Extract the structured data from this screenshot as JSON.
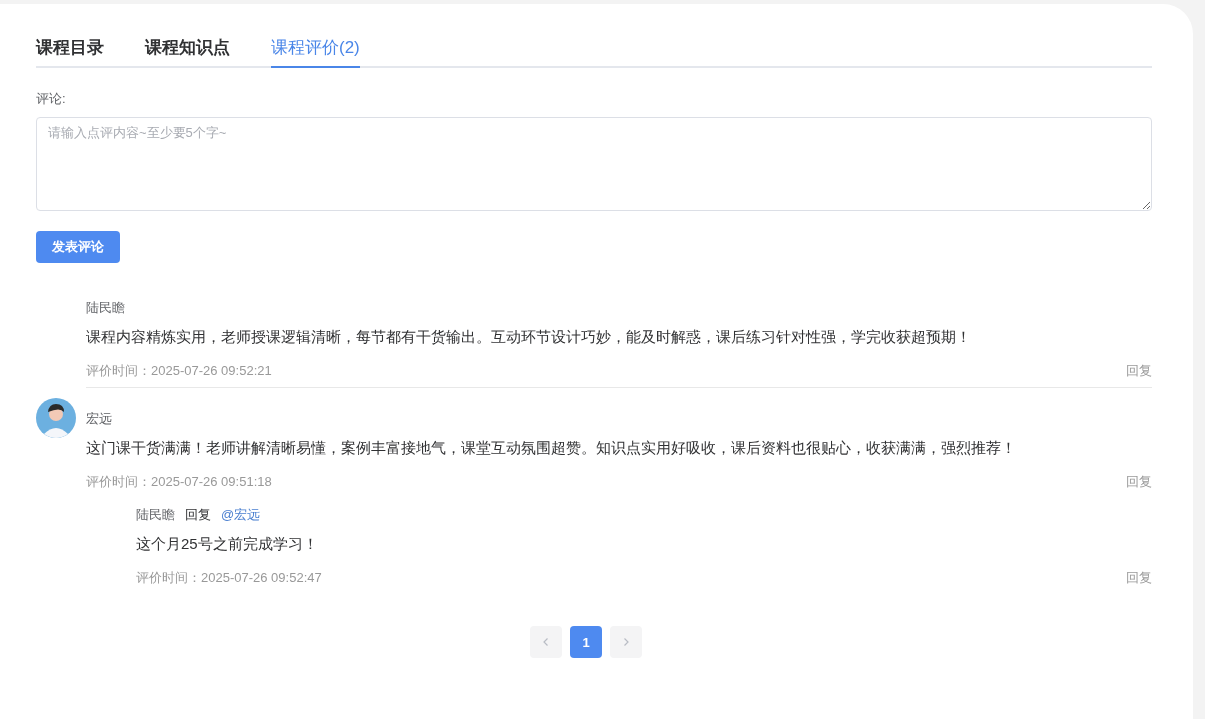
{
  "tabs": [
    {
      "label": "课程目录",
      "selected": false
    },
    {
      "label": "课程知识点",
      "selected": false
    },
    {
      "label": "课程评价(2)",
      "selected": true
    }
  ],
  "comment_form": {
    "label": "评论:",
    "placeholder": "请输入点评内容~至少要5个字~",
    "submit": "发表评论"
  },
  "comments": [
    {
      "avatar": false,
      "author": "陆民瞻",
      "text": "课程内容精炼实用，老师授课逻辑清晰，每节都有干货输出。互动环节设计巧妙，能及时解惑，课后练习针对性强，学完收获超预期！",
      "time": "评价时间：2025-07-26 09:52:21",
      "reply_link": "回复"
    },
    {
      "avatar": true,
      "author": "宏远",
      "text": "这门课干货满满！老师讲解清晰易懂，案例丰富接地气，课堂互动氛围超赞。知识点实用好吸收，课后资料也很贴心，收获满满，强烈推荐！",
      "time": "评价时间：2025-07-26 09:51:18",
      "reply_link": "回复",
      "replies": [
        {
          "author": "陆民瞻",
          "reply_word": "回复",
          "target": "@宏远",
          "text": "这个月25号之前完成学习！",
          "time": "评价时间：2025-07-26 09:52:47",
          "reply_link": "回复"
        }
      ]
    }
  ],
  "pagination": {
    "prev_disabled": true,
    "next_disabled": true,
    "pages": [
      {
        "label": "1",
        "selected": true
      }
    ]
  }
}
